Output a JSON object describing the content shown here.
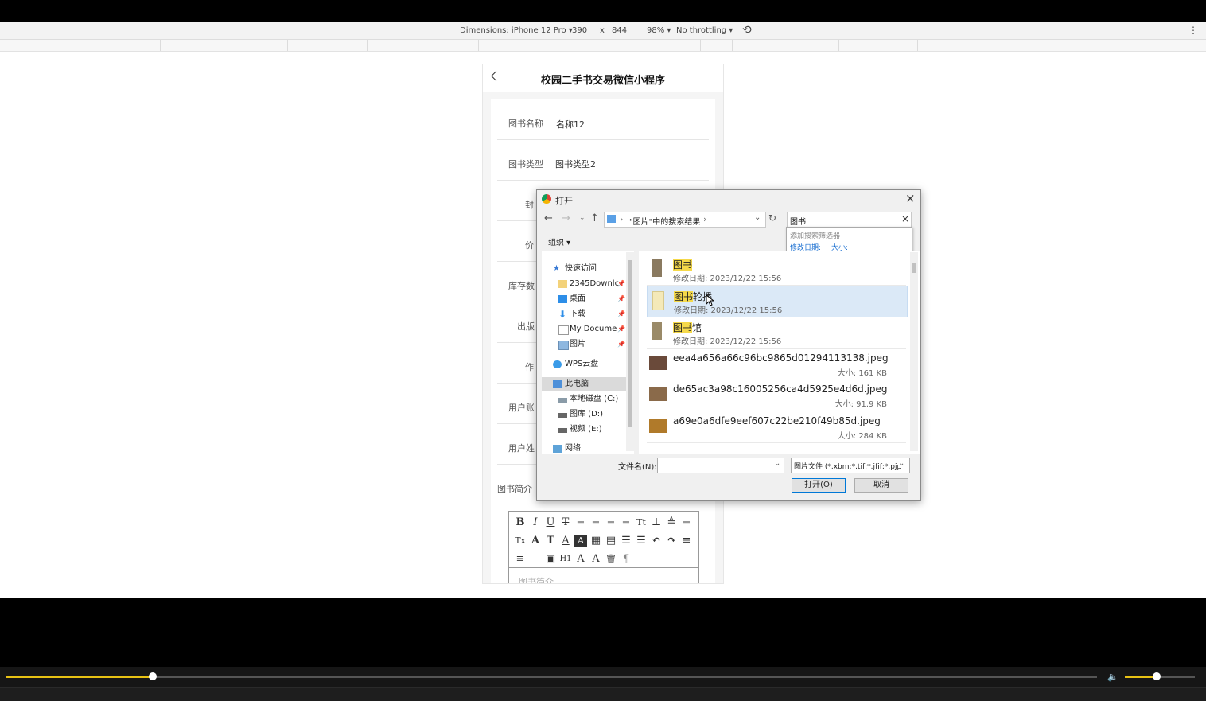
{
  "devtools": {
    "dimensions_label": "Dimensions: iPhone 12 Pro ▾",
    "width": "390",
    "times": "x",
    "height": "844",
    "zoom": "98% ▾",
    "throttling": "No throttling ▾"
  },
  "app": {
    "title": "校园二手书交易微信小程序",
    "fields": [
      {
        "label": "图书名称",
        "value": "名称12"
      },
      {
        "label": "图书类型",
        "value": "图书类型2"
      },
      {
        "label": "封",
        "value": ""
      },
      {
        "label": "价",
        "value": ""
      },
      {
        "label": "库存数",
        "value": ""
      },
      {
        "label": "出版",
        "value": ""
      },
      {
        "label": "作",
        "value": ""
      },
      {
        "label": "用户账",
        "value": ""
      },
      {
        "label": "用户姓",
        "value": ""
      }
    ],
    "intro_label": "图书简介",
    "editor_placeholder": "图书简介",
    "toolbar": {
      "row1": [
        "B",
        "I",
        "U",
        "T",
        "≡",
        "≡",
        "≡",
        "≡",
        "Tt",
        "⊥",
        "≜",
        "≡"
      ],
      "row2": [
        "Tx",
        "A",
        "T",
        "A",
        "A",
        "▦",
        "▤",
        "☰",
        "☰",
        "↶",
        "↷",
        "≡"
      ],
      "row3": [
        "≡",
        "—",
        "▣",
        "H1",
        "A",
        "A",
        "🗑",
        "¶"
      ]
    }
  },
  "dialog": {
    "title": "打开",
    "breadcrumb_sep": "›",
    "breadcrumb": "\"图片\"中的搜索结果",
    "search_value": "图书",
    "search_hint": "添加搜索筛选器",
    "filter_date": "修改日期:",
    "filter_size": "大小:",
    "organize": "组织 ▾",
    "nav": {
      "quick_access": "快速访问",
      "downloads_folder": "2345Downlc",
      "desktop": "桌面",
      "downloads": "下载",
      "documents": "My Docume",
      "pictures": "图片",
      "wps": "WPS云盘",
      "this_pc": "此电脑",
      "drive_c": "本地磁盘 (C:)",
      "drive_d": "图库 (D:)",
      "drive_e": "视频 (E:)",
      "network": "网络"
    },
    "files": [
      {
        "hl": "图书",
        "rest": "",
        "meta": "修改日期: 2023/12/22 15:56",
        "size": ""
      },
      {
        "hl": "图书",
        "rest": "轮播",
        "meta": "修改日期: 2023/12/22 15:56",
        "size": ""
      },
      {
        "hl": "图书",
        "rest": "馆",
        "meta": "修改日期: 2023/12/22 15:56",
        "size": ""
      },
      {
        "hl": "",
        "rest": "eea4a656a66c96bc9865d01294113138.jpeg",
        "meta": "",
        "size": "大小: 161 KB"
      },
      {
        "hl": "",
        "rest": "de65ac3a98c16005256ca4d5925e4d6d.jpeg",
        "meta": "",
        "size": "大小: 91.9 KB"
      },
      {
        "hl": "",
        "rest": "a69e0a6dfe9eef607c22be210f49b85d.jpeg",
        "meta": "",
        "size": "大小: 284 KB"
      }
    ],
    "filename_label": "文件名(N):",
    "filetype": "图片文件 (*.xbm;*.tif;*.jfif;*.pjp",
    "open_button": "打开(O)",
    "cancel_button": "取消"
  },
  "player": {
    "progress": 0.135,
    "volume": 0.45
  }
}
